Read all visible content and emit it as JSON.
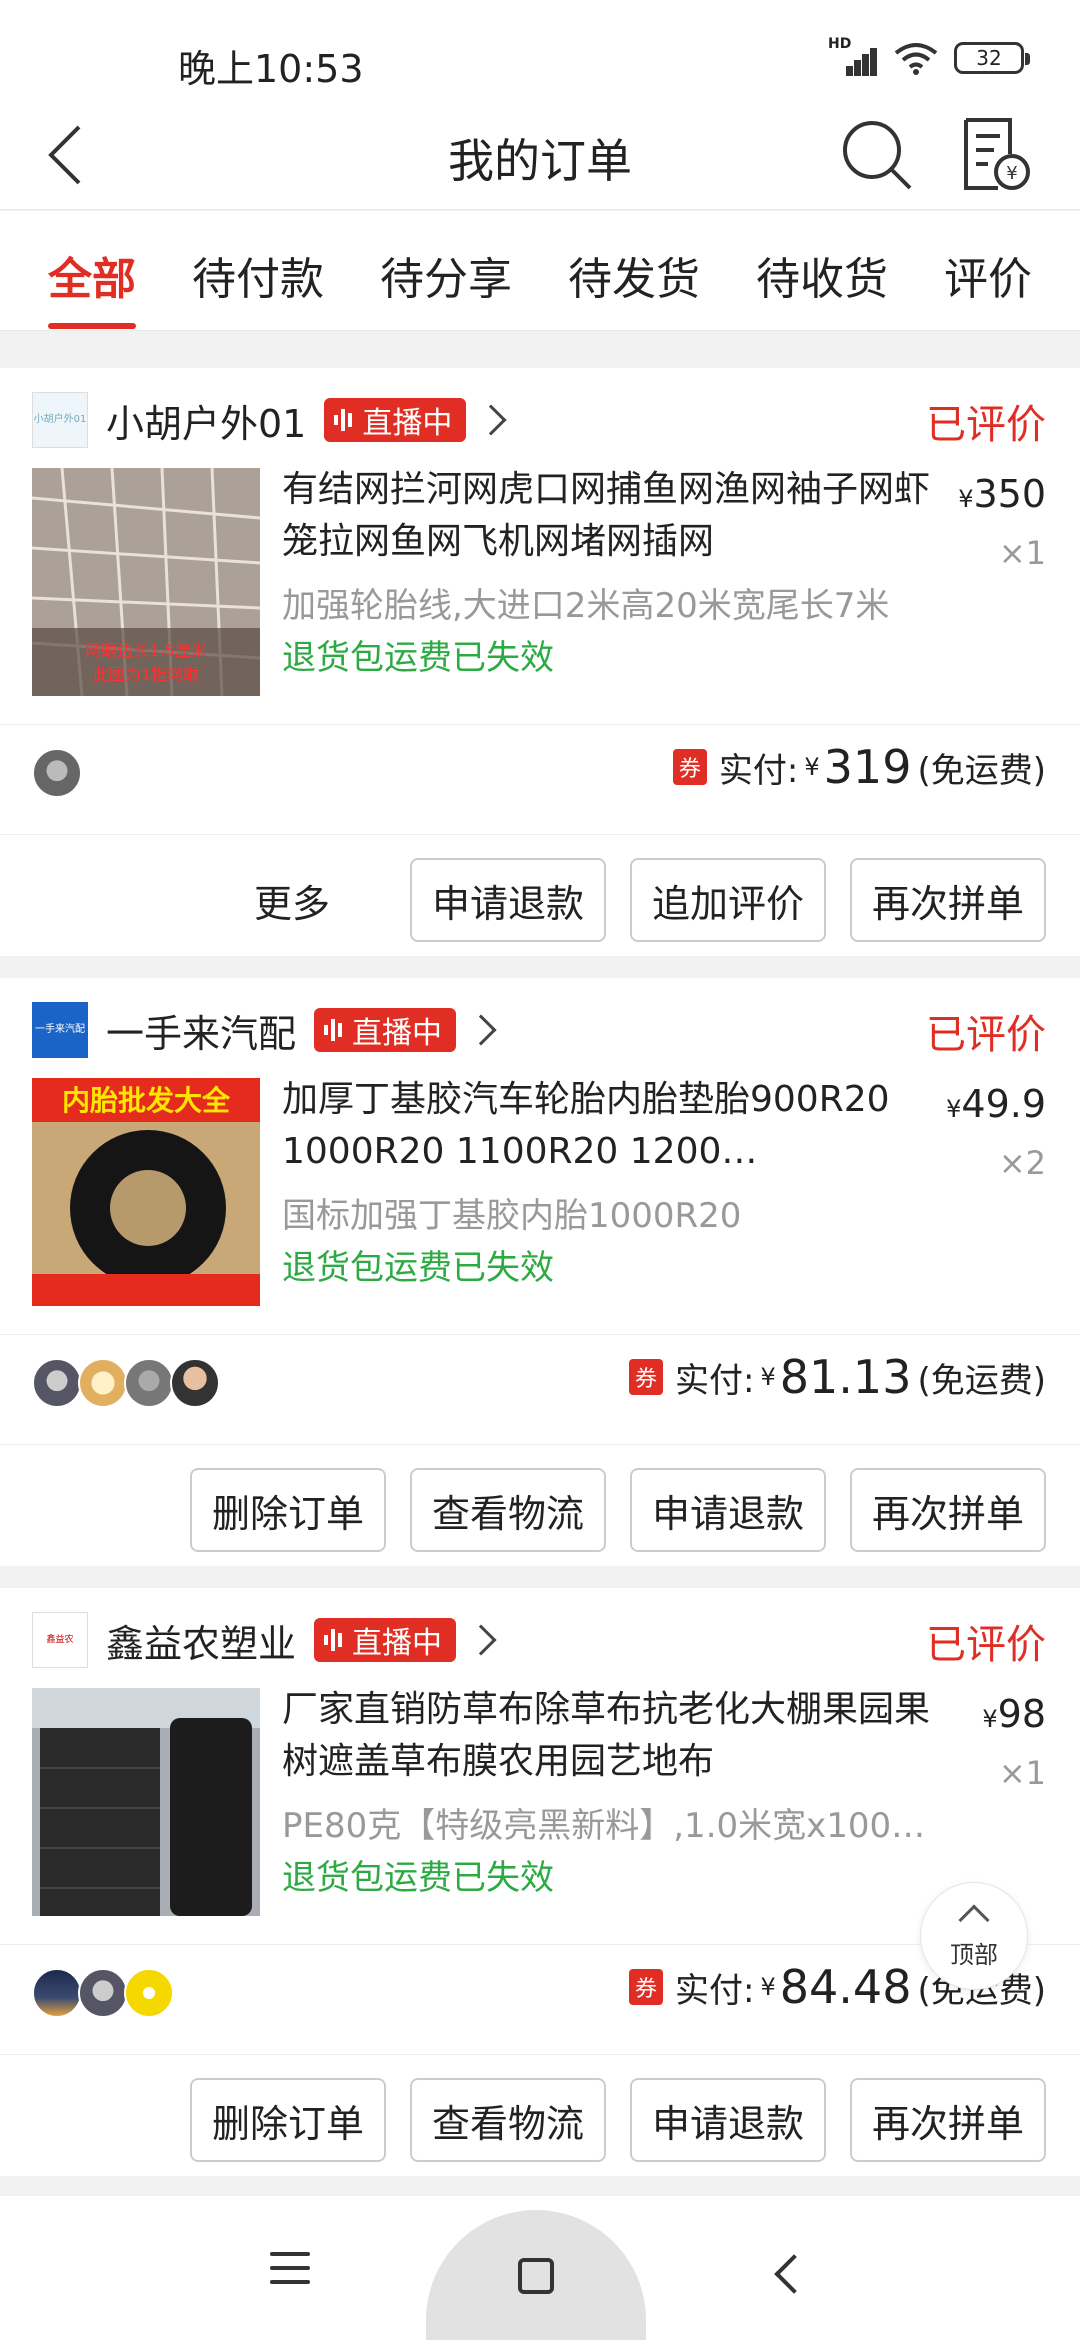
{
  "status_bar": {
    "time": "晚上10:53",
    "network": "HD",
    "battery": "32"
  },
  "header": {
    "title": "我的订单"
  },
  "tabs": [
    {
      "label": "全部",
      "active": true
    },
    {
      "label": "待付款"
    },
    {
      "label": "待分享"
    },
    {
      "label": "待发货"
    },
    {
      "label": "待收货"
    },
    {
      "label": "评价"
    }
  ],
  "orders": [
    {
      "shop_name": "小胡户外01",
      "shop_logo_text": "小胡户外01",
      "live_label": "直播中",
      "status": "已评价",
      "product_name": "有结网拦河网虎口网捕鱼网渔网袖子网虾笼拉网鱼网飞机网堵网插网",
      "price_symbol": "¥",
      "price": "350",
      "quantity": "×1",
      "spec": "加强轮胎线,大进口2米高20米宽尾长7米",
      "policy": "退货包运费已失效",
      "thumb_text": "网眼边长1.5厘米 此图为1指网眼",
      "coupon": "券",
      "paid_label": "实付:",
      "paid_symbol": "¥",
      "paid_amount": "319",
      "shipping": "(免运费)",
      "buttons": [
        "申请退款",
        "追加评价",
        "再次拼单"
      ],
      "more": "更多"
    },
    {
      "shop_name": "一手来汽配",
      "shop_logo_text": "一手来汽配",
      "live_label": "直播中",
      "status": "已评价",
      "product_name": "加厚丁基胶汽车轮胎内胎垫胎900R20 1000R20 1100R20 1200…",
      "price_symbol": "¥",
      "price": "49.9",
      "quantity": "×2",
      "spec": "国标加强丁基胶内胎1000R20",
      "policy": "退货包运费已失效",
      "thumb_text": "内胎批发大全",
      "coupon": "券",
      "paid_label": "实付:",
      "paid_symbol": "¥",
      "paid_amount": "81.13",
      "shipping": "(免运费)",
      "buttons": [
        "删除订单",
        "查看物流",
        "申请退款",
        "再次拼单"
      ]
    },
    {
      "shop_name": "鑫益农塑业",
      "shop_logo_text": "鑫益农",
      "live_label": "直播中",
      "status": "已评价",
      "product_name": "厂家直销防草布除草布抗老化大棚果园果树遮盖草布膜农用园艺地布",
      "price_symbol": "¥",
      "price": "98",
      "quantity": "×1",
      "spec": "PE80克【特级亮黑新料】,1.0米宽x100…",
      "policy": "退货包运费已失效",
      "coupon": "券",
      "paid_label": "实付:",
      "paid_symbol": "¥",
      "paid_amount": "84.48",
      "shipping": "(免运费)",
      "buttons": [
        "删除订单",
        "查看物流",
        "申请退款",
        "再次拼单"
      ]
    }
  ],
  "back_to_top": "顶部",
  "colors": {
    "accent": "#e02e24",
    "green": "#2eaa44",
    "gray_text": "#999999"
  }
}
